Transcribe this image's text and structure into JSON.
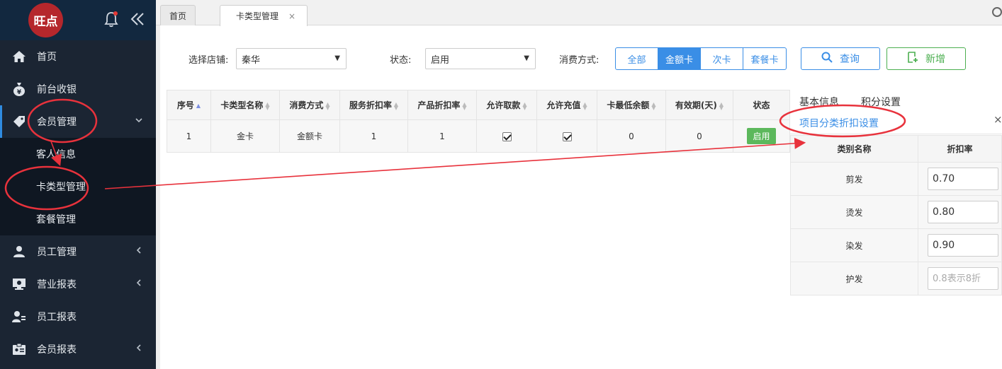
{
  "sidebar": {
    "logo_text": "旺点",
    "collapse_glyph": "《",
    "items": [
      {
        "label": "首页",
        "icon": "home-icon"
      },
      {
        "label": "前台收银",
        "icon": "money-bag-icon"
      },
      {
        "label": "会员管理",
        "icon": "tag-icon",
        "open": true,
        "children": [
          {
            "label": "客人信息"
          },
          {
            "label": "卡类型管理"
          },
          {
            "label": "套餐管理"
          }
        ]
      },
      {
        "label": "员工管理",
        "icon": "person-icon"
      },
      {
        "label": "营业报表",
        "icon": "monitor-chart-icon"
      },
      {
        "label": "员工报表",
        "icon": "person-list-icon"
      },
      {
        "label": "会员报表",
        "icon": "id-card-icon"
      }
    ]
  },
  "tabs": [
    {
      "label": "首页"
    },
    {
      "label": "卡类型管理",
      "close": "×"
    }
  ],
  "filters": {
    "store_label": "选择店铺:",
    "store_value": "秦华",
    "status_label": "状态:",
    "status_value": "启用",
    "consume_label": "消费方式:",
    "consume_options": [
      "全部",
      "金额卡",
      "次卡",
      "套餐卡"
    ],
    "consume_selected": 1,
    "query_button": "查询",
    "add_button": "新增"
  },
  "table": {
    "headers": [
      "序号",
      "卡类型名称",
      "消费方式",
      "服务折扣率",
      "产品折扣率",
      "允许取款",
      "允许充值",
      "卡最低余额",
      "有效期(天)",
      "状态"
    ],
    "rows": [
      {
        "index": "1",
        "name": "金卡",
        "consume": "金额卡",
        "service_rate": "1",
        "product_rate": "1",
        "allow_withdraw": true,
        "allow_recharge": true,
        "min_balance": "0",
        "validity": "0",
        "status": "启用"
      }
    ]
  },
  "right_panel": {
    "tabs": [
      "基本信息",
      "积分设置",
      "项目分类折扣设置"
    ],
    "active_tab": 2,
    "close": "×",
    "headers": [
      "类别名称",
      "折扣率"
    ],
    "rows": [
      {
        "category": "剪发",
        "rate": "0.70",
        "placeholder": ""
      },
      {
        "category": "烫发",
        "rate": "0.80",
        "placeholder": ""
      },
      {
        "category": "染发",
        "rate": "0.90",
        "placeholder": ""
      },
      {
        "category": "护发",
        "rate": "",
        "placeholder": "0.8表示8折"
      }
    ]
  },
  "colors": {
    "sidebar_bg": "#1b2533",
    "accent_blue": "#3a8ee6",
    "success_green": "#5cb85c",
    "annotation_red": "#e8323c"
  }
}
